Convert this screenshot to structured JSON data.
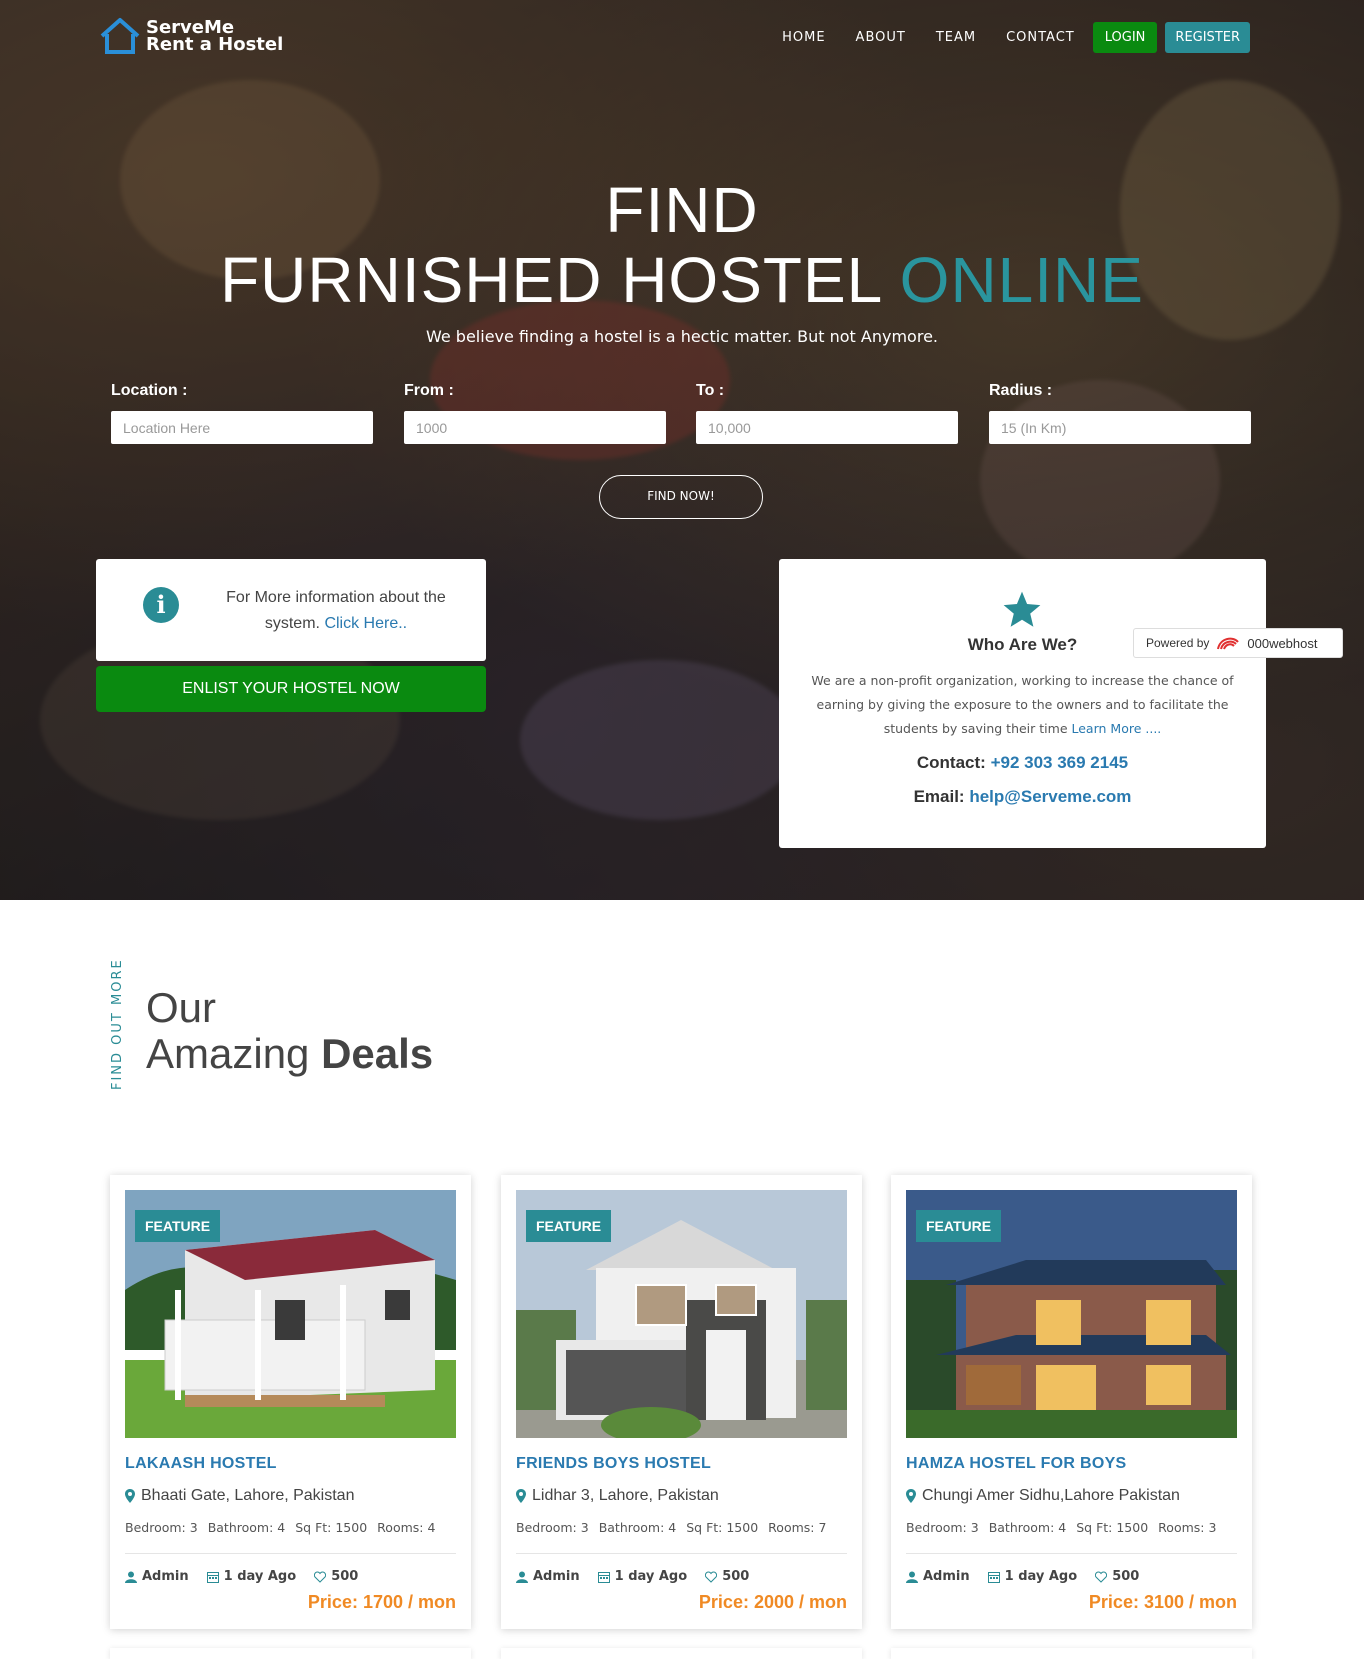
{
  "brand": {
    "line1": "ServeMe",
    "line2": "Rent a Hostel"
  },
  "nav": {
    "home": "HOME",
    "about": "ABOUT",
    "team": "TEAM",
    "contact": "CONTACT",
    "login": "LOGIN",
    "register": "REGISTER"
  },
  "hero": {
    "title1": "FIND",
    "title2": "FURNISHED HOSTEL",
    "title_accent": "ONLINE",
    "subtitle": "We believe finding a hostel is a hectic matter. But not Anymore."
  },
  "search": {
    "location_label": "Location :",
    "location_placeholder": "Location Here",
    "from_label": "From :",
    "from_placeholder": "1000",
    "to_label": "To :",
    "to_placeholder": "10,000",
    "radius_label": "Radius :",
    "radius_placeholder": "15 (In Km)",
    "button": "FIND NOW!"
  },
  "info": {
    "text": "For More information about the system.",
    "link": "Click Here.."
  },
  "enlist": "ENLIST YOUR HOSTEL NOW",
  "who": {
    "title": "Who Are We?",
    "desc": "We are a non-profit organization, working to increase the chance of earning by giving the exposure to the owners and to facilitate the students by saving their time",
    "link": "Learn More ....",
    "contact_label": "Contact:",
    "contact_value": "+92 303 369 2145",
    "email_label": "Email:",
    "email_value": "help@Serveme.com"
  },
  "powered": {
    "label": "Powered by",
    "brand": "000webhost"
  },
  "deals": {
    "tag": "FIND  OUT  MORE",
    "title1": "Our",
    "title2a": "Amazing ",
    "title2b": "Deals"
  },
  "cards": [
    {
      "feature": "FEATURE",
      "name": "LAKAASH HOSTEL",
      "location": "Bhaati Gate, Lahore, Pakistan",
      "bedroom": "Bedroom: 3",
      "bathroom": "Bathroom: 4",
      "sqft": "Sq Ft: 1500",
      "rooms": "Rooms: 4",
      "author": "Admin",
      "date": "1 day Ago",
      "likes": "500",
      "price": "Price: 1700 / mon"
    },
    {
      "feature": "FEATURE",
      "name": "FRIENDS BOYS HOSTEL",
      "location": "Lidhar 3, Lahore, Pakistan",
      "bedroom": "Bedroom: 3",
      "bathroom": "Bathroom: 4",
      "sqft": "Sq Ft: 1500",
      "rooms": "Rooms: 7",
      "author": "Admin",
      "date": "1 day Ago",
      "likes": "500",
      "price": "Price: 2000 / mon"
    },
    {
      "feature": "FEATURE",
      "name": "HAMZA HOSTEL FOR BOYS",
      "location": "Chungi Amer Sidhu,Lahore Pakistan",
      "bedroom": "Bedroom: 3",
      "bathroom": "Bathroom: 4",
      "sqft": "Sq Ft: 1500",
      "rooms": "Rooms: 3",
      "author": "Admin",
      "date": "1 day Ago",
      "likes": "500",
      "price": "Price: 3100 / mon"
    }
  ],
  "colors": {
    "accent": "#2a8c95",
    "green": "#0a8a10",
    "link": "#2a7ab0",
    "price": "#f08a24"
  }
}
